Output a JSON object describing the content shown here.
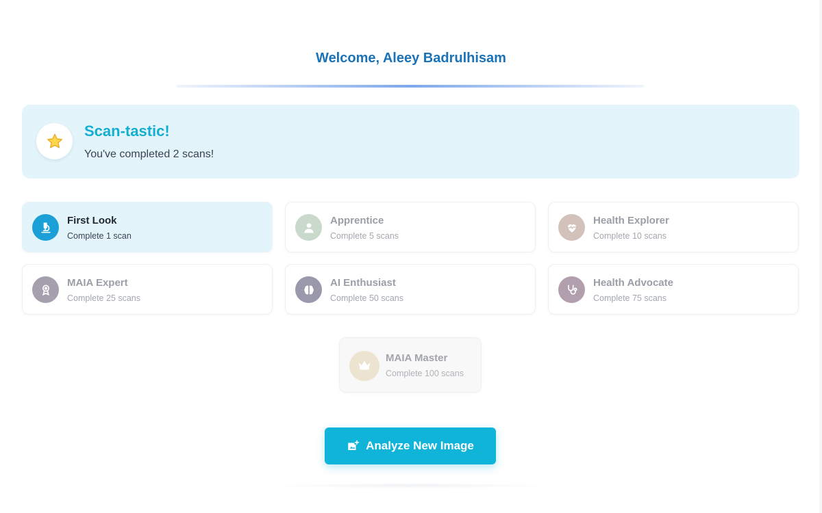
{
  "welcome": "Welcome, Aleey Badrulhisam",
  "banner": {
    "icon": "star-icon",
    "title": "Scan-tastic!",
    "message": "You've completed 2 scans!"
  },
  "achievements": [
    {
      "title": "First Look",
      "subtitle": "Complete 1 scan",
      "icon": "microscope-icon",
      "unlocked": true,
      "color": "#1a9fd6"
    },
    {
      "title": "Apprentice",
      "subtitle": "Complete 5 scans",
      "icon": "doctor-icon",
      "unlocked": false,
      "color": "#c9d9cc"
    },
    {
      "title": "Health Explorer",
      "subtitle": "Complete 10 scans",
      "icon": "heart-pulse-icon",
      "unlocked": false,
      "color": "#d2c2bb"
    },
    {
      "title": "MAIA Expert",
      "subtitle": "Complete 25 scans",
      "icon": "award-icon",
      "unlocked": false,
      "color": "#a69fae"
    },
    {
      "title": "AI Enthusiast",
      "subtitle": "Complete 50 scans",
      "icon": "brain-icon",
      "unlocked": false,
      "color": "#9a98ab"
    },
    {
      "title": "Health Advocate",
      "subtitle": "Complete 75 scans",
      "icon": "stethoscope-icon",
      "unlocked": false,
      "color": "#b29fae"
    }
  ],
  "master": {
    "title": "MAIA Master",
    "subtitle": "Complete 100 scans",
    "icon": "crown-icon",
    "unlocked": false,
    "color": "#ece3d1"
  },
  "action": {
    "label": "Analyze New Image",
    "icon": "add-photo-icon",
    "color": "#0fb4d8"
  }
}
